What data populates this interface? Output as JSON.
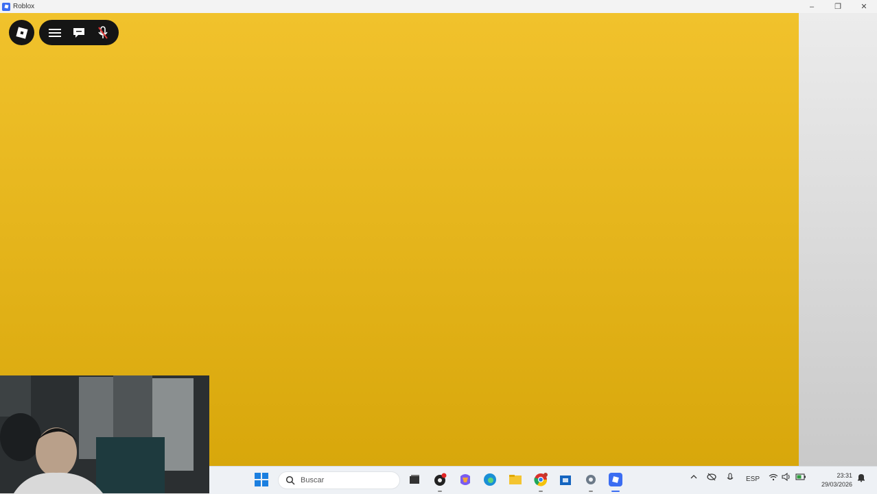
{
  "window": {
    "title": "Roblox",
    "minimize": "–",
    "maximize": "❐",
    "close": "✕"
  },
  "game": {
    "background_top": "#f1c22c",
    "background_bottom": "#d8a70b"
  },
  "roblox_controls": {
    "logo_icon": "roblox-logo-icon",
    "menu_icon": "hamburger-menu-icon",
    "chat_icon": "chat-bubble-icon",
    "mic_icon": "microphone-muted-icon"
  },
  "taskbar": {
    "search_placeholder": "Buscar",
    "language": "ESP",
    "time": "23:31",
    "date": "29/03/2026",
    "apps": [
      "widgets-icon",
      "task-view-icon",
      "media-app-icon",
      "copilot-icon",
      "edge-icon",
      "file-explorer-icon",
      "chrome-icon",
      "store-icon",
      "settings-icon",
      "roblox-icon"
    ],
    "tray_icons": [
      "chevron-up-icon",
      "camera-off-icon",
      "microphone-icon",
      "wifi-icon",
      "volume-icon",
      "battery-icon",
      "notification-icon"
    ]
  }
}
